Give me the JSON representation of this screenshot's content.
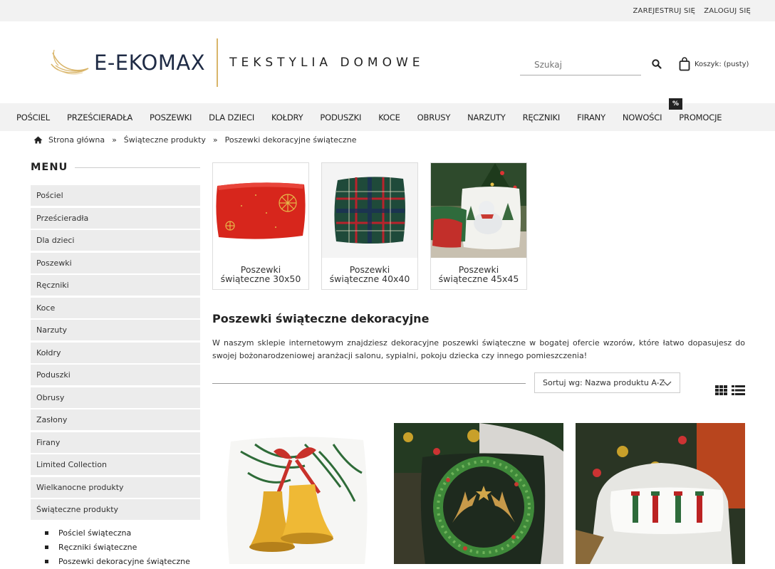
{
  "topbar": {
    "register": "ZAREJESTRUJ SIĘ",
    "login": "ZALOGUJ SIĘ"
  },
  "logo": {
    "brand": "E-EKOMAX",
    "tagline": "TEKSTYLIA DOMOWE"
  },
  "search": {
    "placeholder": "Szukaj",
    "icon": "search-icon"
  },
  "cart": {
    "label": "Koszyk: (pusty)",
    "icon": "shopping-bag-icon"
  },
  "nav": {
    "items": [
      "POŚCIEL",
      "PRZEŚCIERADŁA",
      "POSZEWKI",
      "DLA DZIECI",
      "KOŁDRY",
      "PODUSZKI",
      "KOCE",
      "OBRUSY",
      "NARZUTY",
      "RĘCZNIKI",
      "FIRANY",
      "NOWOŚCI",
      "PROMOCJE"
    ],
    "promo_badge": "%"
  },
  "breadcrumb": {
    "home_icon": "home-icon",
    "items": [
      "Strona główna",
      "Świąteczne produkty",
      "Poszewki dekoracyjne świąteczne"
    ],
    "separator": "»"
  },
  "sidebar": {
    "title": "MENU",
    "categories": [
      "Pościel",
      "Prześcieradła",
      "Dla dzieci",
      "Poszewki",
      "Ręczniki",
      "Koce",
      "Narzuty",
      "Kołdry",
      "Poduszki",
      "Obrusy",
      "Zasłony",
      "Firany",
      "Limited Collection",
      "Wielkanocne produkty",
      "Świąteczne produkty"
    ],
    "subcategories": [
      "Pościel świąteczna",
      "Ręczniki świąteczne",
      "Poszewki dekoracyjne świąteczne"
    ]
  },
  "subcats": [
    {
      "line1": "Poszewki",
      "line2": "świąteczne 30x50"
    },
    {
      "line1": "Poszewki",
      "line2": "świąteczne 40x40"
    },
    {
      "line1": "Poszewki",
      "line2": "świąteczne 45x45"
    }
  ],
  "section": {
    "title": "Poszewki świąteczne dekoracyjne",
    "description": "W naszym sklepie internetowym znajdziesz dekoracyjne poszewki świąteczne w bogatej ofercie wzorów, które łatwo dopasujesz do swojej bożonarodzeniowej aranżacji salonu, sypialni, pokoju dziecka czy innego pomieszczenia!"
  },
  "sort": {
    "label": "Sortuj wg: Nazwa produktu A-Z"
  },
  "colors": {
    "topbar_bg": "#f2f2f2",
    "nav_bg": "#f2f2f2",
    "accent_gold": "#d9b56a",
    "brand_navy": "#1f2b45"
  }
}
